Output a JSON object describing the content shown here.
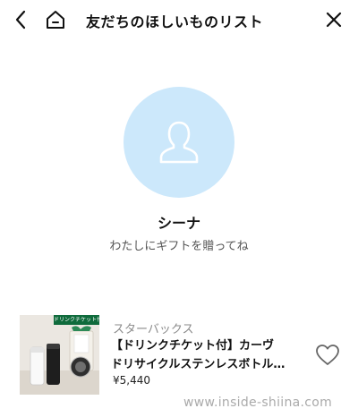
{
  "header": {
    "title": "友だちのほしいものリスト",
    "back_icon": "chevron-left-icon",
    "home_icon": "home-icon",
    "close_icon": "close-icon"
  },
  "profile": {
    "avatar_icon": "person-icon",
    "avatar_color": "#cce8fb",
    "name": "シーナ",
    "message": "わたしにギフトを贈ってね"
  },
  "product": {
    "tag": "ドリンクチケット付",
    "brand": "スターバックス",
    "name_line1": "【ドリンクチケット付】カーヴ",
    "name_line2": "ドリサイクルステンレスボトル…",
    "price": "¥5,440",
    "favorite_icon": "heart-icon"
  },
  "watermark": "www.inside-shiina.com"
}
